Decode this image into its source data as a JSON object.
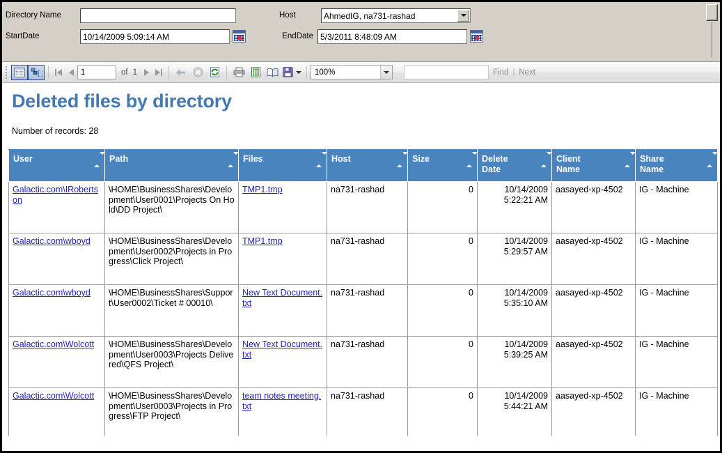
{
  "parameters": {
    "directory_name": {
      "label": "Directory Name",
      "value": "",
      "placeholder": ""
    },
    "start_date": {
      "label": "StartDate",
      "value": "10/14/2009 5:09:14 AM",
      "calendar_icon": "calendar-icon"
    },
    "end_date": {
      "label": "EndDate",
      "value": "5/3/2011 8:48:09 AM",
      "calendar_icon": "calendar-icon"
    },
    "host": {
      "label": "Host",
      "value": "AhmedIG, na731-rashad",
      "options": [
        "AhmedIG, na731-rashad"
      ]
    }
  },
  "toolbar": {
    "parameters_toggle": "parameters-pane-icon",
    "document_map_toggle": "document-map-icon",
    "first_page": "first-page-icon",
    "prev_page": "previous-page-icon",
    "page_number": "1",
    "of_label": "of",
    "page_count": "1",
    "next_page": "next-page-icon",
    "last_page": "last-page-icon",
    "back_parent": "back-to-parent-icon",
    "stop": "stop-icon",
    "refresh": "refresh-icon",
    "print": "print-icon",
    "page_setup": "page-setup-icon",
    "print_layout": "print-layout-icon",
    "export": "export-save-icon",
    "export_dropdown": "chevron-down-icon",
    "zoom": "100%",
    "zoom_options": [
      "100%"
    ],
    "find_value": "",
    "find_label": "Find",
    "find_separator": "|",
    "next_label": "Next"
  },
  "report": {
    "title": "Deleted files by directory",
    "record_count_text": "Number of records: 28",
    "columns": [
      {
        "label": "User",
        "key": "user"
      },
      {
        "label": "Path",
        "key": "path"
      },
      {
        "label": "Files",
        "key": "files"
      },
      {
        "label": "Host",
        "key": "host"
      },
      {
        "label": "Size",
        "key": "size"
      },
      {
        "label": "Delete\nDate",
        "key": "delete_date"
      },
      {
        "label": "Client\nName",
        "key": "client_name"
      },
      {
        "label": "Share\nName",
        "key": "share_name"
      }
    ],
    "rows": [
      {
        "user": "Galactic.com\\IRobertson",
        "path": "\\HOME\\BusinessShares\\Development\\User0001\\Projects On Hold\\DD Project\\",
        "files": "TMP1.tmp",
        "host": "na731-rashad",
        "size": "0",
        "delete_date": "10/14/2009\n5:22:21 AM",
        "client_name": "aasayed-xp-4502",
        "share_name": "IG - Machine"
      },
      {
        "user": "Galactic.com\\wboyd",
        "path": "\\HOME\\BusinessShares\\Development\\User0002\\Projects in Progress\\Click Project\\",
        "files": "TMP1.tmp",
        "host": "na731-rashad",
        "size": "0",
        "delete_date": "10/14/2009\n5:29:57 AM",
        "client_name": "aasayed-xp-4502",
        "share_name": "IG - Machine"
      },
      {
        "user": "Galactic.com\\wboyd",
        "path": "\\HOME\\BusinessShares\\Support\\User0002\\Ticket # 00010\\",
        "files": "New Text Document.txt",
        "host": "na731-rashad",
        "size": "0",
        "delete_date": "10/14/2009\n5:35:10 AM",
        "client_name": "aasayed-xp-4502",
        "share_name": "IG - Machine"
      },
      {
        "user": "Galactic.com\\Wolcott",
        "path": "\\HOME\\BusinessShares\\Development\\User0003\\Projects Delivered\\QFS Project\\",
        "files": "New Text Document.txt",
        "host": "na731-rashad",
        "size": "0",
        "delete_date": "10/14/2009\n5:39:25 AM",
        "client_name": "aasayed-xp-4502",
        "share_name": "IG - Machine"
      },
      {
        "user": "Galactic.com\\Wolcott",
        "path": "\\HOME\\BusinessShares\\Development\\User0003\\Projects in Progress\\FTP Project\\",
        "files": "team notes meeting.txt",
        "host": "na731-rashad",
        "size": "0",
        "delete_date": "10/14/2009\n5:44:21 AM",
        "client_name": "aasayed-xp-4502",
        "share_name": "IG - Machine"
      }
    ]
  },
  "colors": {
    "header_blue": "#4a84be",
    "title_blue": "#4479b0",
    "link_blue": "#2222cc",
    "panel_gray": "#d4d0c8"
  }
}
